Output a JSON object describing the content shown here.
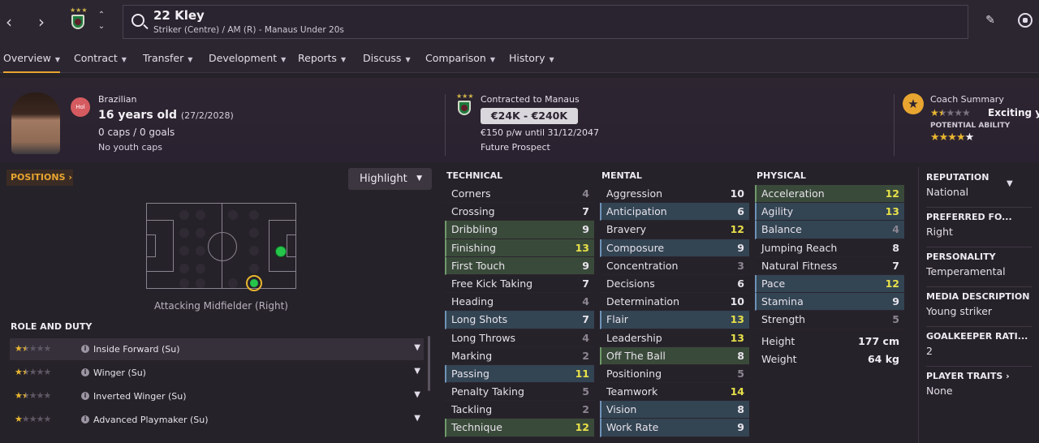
{
  "topbar": {
    "back_icon": "chevron-left-icon",
    "forward_icon": "chevron-right-icon",
    "player_name": "22 Kley",
    "player_subtitle": "Striker (Centre) / AM (R) - Manaus Under 20s"
  },
  "tabs": [
    {
      "label": "Overview",
      "active": true
    },
    {
      "label": "Contract"
    },
    {
      "label": "Transfer"
    },
    {
      "label": "Development"
    },
    {
      "label": "Reports"
    },
    {
      "label": "Discuss"
    },
    {
      "label": "Comparison"
    },
    {
      "label": "History"
    }
  ],
  "header": {
    "status_badge": "Hol",
    "nationality": "Brazilian",
    "age": "16 years old",
    "dob": "(27/2/2028)",
    "caps": "0 caps / 0 goals",
    "youth_caps": "No youth caps",
    "contract_label": "Contracted to Manaus",
    "value": "€24K - €240K",
    "wage": "€150 p/w until 31/12/2047",
    "prospect": "Future Prospect",
    "coach_title": "Coach Summary",
    "coach_text": "Exciting young",
    "current_ability_stars": 1.5,
    "potential_label": "POTENTIAL ABILITY",
    "potential_ability_stars": 4.5
  },
  "positions": {
    "heading": "POSITIONS",
    "highlight_label": "Highlight",
    "position_label": "Attacking Midfielder (Right)"
  },
  "roles": {
    "heading": "ROLE AND DUTY",
    "items": [
      {
        "name": "Inside Forward (Su)",
        "stars": 1.5
      },
      {
        "name": "Winger (Su)",
        "stars": 1.5
      },
      {
        "name": "Inverted Winger (Su)",
        "stars": 1.5
      },
      {
        "name": "Advanced Playmaker (Su)",
        "stars": 1
      }
    ]
  },
  "technical": {
    "heading": "TECHNICAL",
    "rows": [
      {
        "name": "Corners",
        "value": "4",
        "hl": ""
      },
      {
        "name": "Crossing",
        "value": "7",
        "hl": ""
      },
      {
        "name": "Dribbling",
        "value": "9",
        "hl": "green"
      },
      {
        "name": "Finishing",
        "value": "13",
        "hl": "green"
      },
      {
        "name": "First Touch",
        "value": "9",
        "hl": "green"
      },
      {
        "name": "Free Kick Taking",
        "value": "7",
        "hl": ""
      },
      {
        "name": "Heading",
        "value": "4",
        "hl": ""
      },
      {
        "name": "Long Shots",
        "value": "7",
        "hl": "blue"
      },
      {
        "name": "Long Throws",
        "value": "4",
        "hl": ""
      },
      {
        "name": "Marking",
        "value": "2",
        "hl": ""
      },
      {
        "name": "Passing",
        "value": "11",
        "hl": "blue"
      },
      {
        "name": "Penalty Taking",
        "value": "5",
        "hl": ""
      },
      {
        "name": "Tackling",
        "value": "2",
        "hl": ""
      },
      {
        "name": "Technique",
        "value": "12",
        "hl": "green"
      }
    ]
  },
  "mental": {
    "heading": "MENTAL",
    "rows": [
      {
        "name": "Aggression",
        "value": "10",
        "hl": ""
      },
      {
        "name": "Anticipation",
        "value": "6",
        "hl": "blue"
      },
      {
        "name": "Bravery",
        "value": "12",
        "hl": ""
      },
      {
        "name": "Composure",
        "value": "9",
        "hl": "blue"
      },
      {
        "name": "Concentration",
        "value": "3",
        "hl": ""
      },
      {
        "name": "Decisions",
        "value": "6",
        "hl": ""
      },
      {
        "name": "Determination",
        "value": "10",
        "hl": ""
      },
      {
        "name": "Flair",
        "value": "13",
        "hl": "blue"
      },
      {
        "name": "Leadership",
        "value": "13",
        "hl": ""
      },
      {
        "name": "Off The Ball",
        "value": "8",
        "hl": "green"
      },
      {
        "name": "Positioning",
        "value": "5",
        "hl": ""
      },
      {
        "name": "Teamwork",
        "value": "14",
        "hl": ""
      },
      {
        "name": "Vision",
        "value": "8",
        "hl": "blue"
      },
      {
        "name": "Work Rate",
        "value": "9",
        "hl": "blue"
      }
    ]
  },
  "physical": {
    "heading": "PHYSICAL",
    "rows": [
      {
        "name": "Acceleration",
        "value": "12",
        "hl": "green"
      },
      {
        "name": "Agility",
        "value": "13",
        "hl": "blue"
      },
      {
        "name": "Balance",
        "value": "4",
        "hl": "blue"
      },
      {
        "name": "Jumping Reach",
        "value": "8",
        "hl": ""
      },
      {
        "name": "Natural Fitness",
        "value": "7",
        "hl": ""
      },
      {
        "name": "Pace",
        "value": "12",
        "hl": "blue"
      },
      {
        "name": "Stamina",
        "value": "9",
        "hl": "blue"
      },
      {
        "name": "Strength",
        "value": "5",
        "hl": ""
      }
    ],
    "height_label": "Height",
    "height_value": "177 cm",
    "weight_label": "Weight",
    "weight_value": "64 kg"
  },
  "side": [
    {
      "title": "REPUTATION",
      "value": "National"
    },
    {
      "title": "PREFERRED FO...",
      "value": "Right"
    },
    {
      "title": "PERSONALITY",
      "value": "Temperamental"
    },
    {
      "title": "MEDIA DESCRIPTION",
      "value": "Young striker"
    },
    {
      "title": "GOALKEEPER RATI...",
      "value": "2"
    },
    {
      "title": "PLAYER TRAITS",
      "value": "None"
    }
  ]
}
